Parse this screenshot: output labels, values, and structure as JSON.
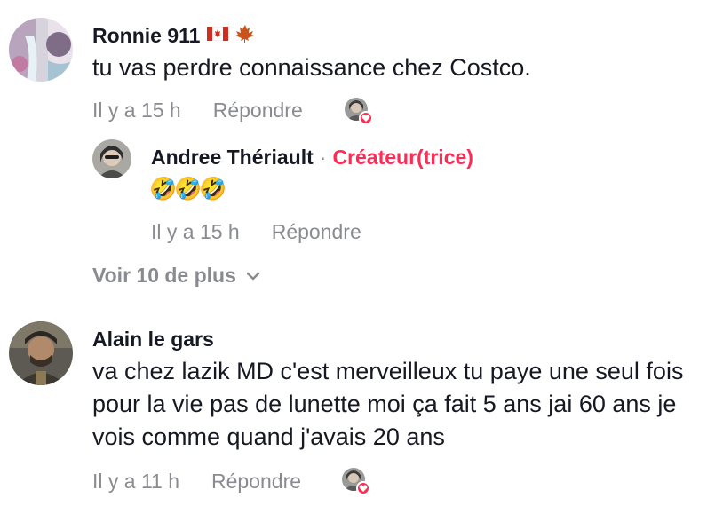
{
  "comments": [
    {
      "username": "Ronnie 911",
      "text": "tu vas perdre connaissance chez Costco.",
      "time": "Il y a 15 h",
      "reply_label": "Répondre",
      "flags": [
        "canada-flag-icon",
        "maple-leaf-icon"
      ],
      "replies": [
        {
          "username": "Andree Thériault",
          "separator": "·",
          "badge": "Créateur(trice)",
          "text": "🤣🤣🤣",
          "time": "Il y a 15 h",
          "reply_label": "Répondre"
        }
      ],
      "view_more": "Voir 10 de plus"
    },
    {
      "username": "Alain le gars",
      "text": "va chez lazik MD c'est merveilleux tu paye une seul fois pour la vie pas de lunette moi ça fait 5 ans jai 60 ans je vois comme quand j'avais 20 ans",
      "time": "Il y a 11 h",
      "reply_label": "Répondre"
    }
  ],
  "colors": {
    "accent": "#fe2c55",
    "muted": "#8a8b91",
    "text": "#161823"
  }
}
